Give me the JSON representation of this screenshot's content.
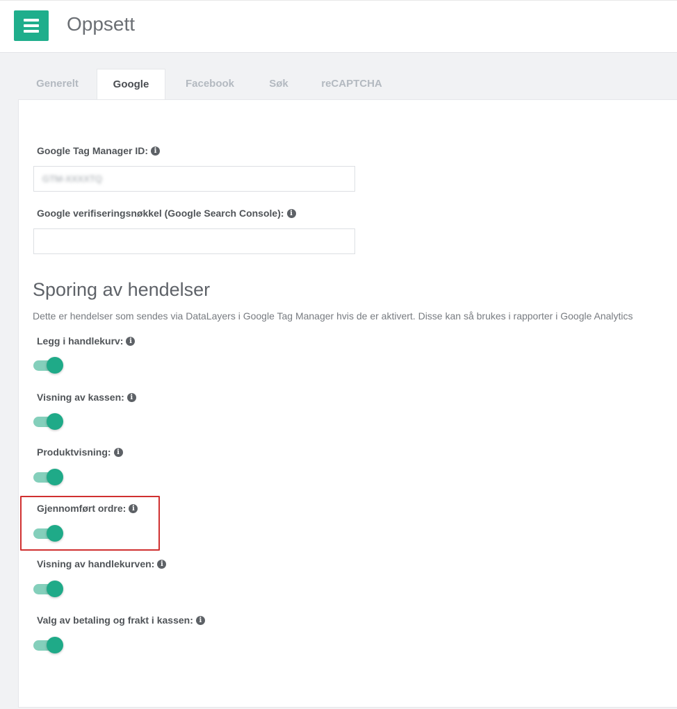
{
  "header": {
    "title": "Oppsett",
    "menu_icon": "hamburger-menu-icon"
  },
  "tabs": [
    {
      "label": "Generelt",
      "active": false
    },
    {
      "label": "Google",
      "active": true
    },
    {
      "label": "Facebook",
      "active": false
    },
    {
      "label": "Søk",
      "active": false
    },
    {
      "label": "reCAPTCHA",
      "active": false
    }
  ],
  "fields": {
    "gtm_label": "Google Tag Manager ID:",
    "gtm_value": "GTM-XXXXTQ",
    "verification_label": "Google verifiseringsnøkkel (Google Search Console):",
    "verification_value": ""
  },
  "events": {
    "title": "Sporing av hendelser",
    "description": "Dette er hendelser som sendes via DataLayers i Google Tag Manager hvis de er aktivert. Disse kan så brukes i rapporter i Google Analytics",
    "items": [
      {
        "label": "Legg i handlekurv:",
        "enabled": true
      },
      {
        "label": "Visning av kassen:",
        "enabled": true
      },
      {
        "label": "Produktvisning:",
        "enabled": true
      },
      {
        "label": "Gjennomført ordre:",
        "enabled": true
      },
      {
        "label": "Visning av handlekurven:",
        "enabled": true
      },
      {
        "label": "Valg av betaling og frakt i kassen:",
        "enabled": true
      }
    ]
  },
  "colors": {
    "accent": "#1fae8c",
    "highlight": "#d03030"
  },
  "info_glyph": "i"
}
